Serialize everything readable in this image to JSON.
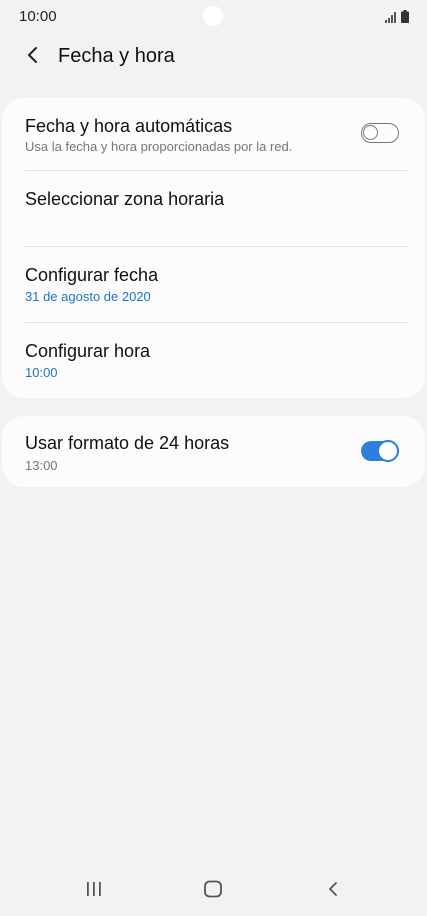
{
  "status_bar": {
    "time": "10:00",
    "icons": [
      "signal-icon",
      "battery-icon"
    ]
  },
  "header": {
    "back_icon": "back-arrow-icon",
    "title": "Fecha y hora"
  },
  "settings": {
    "auto": {
      "title": "Fecha y hora automáticas",
      "subtitle": "Usa la fecha y hora proporcionadas por la red.",
      "toggle_on": false
    },
    "timezone": {
      "title": "Seleccionar zona horaria"
    },
    "date": {
      "title": "Configurar fecha",
      "value": "31 de agosto de 2020"
    },
    "time": {
      "title": "Configurar hora",
      "value": "10:00"
    },
    "format24": {
      "title": "Usar formato de 24 horas",
      "subtitle": "13:00",
      "toggle_on": true
    }
  },
  "nav_bar": {
    "icons": [
      "recent-apps-icon",
      "home-icon",
      "back-icon"
    ]
  },
  "colors": {
    "accent": "#2d7ee0",
    "link": "#1c75c8",
    "background": "#f2f2f2",
    "card": "#fcfcfc"
  }
}
